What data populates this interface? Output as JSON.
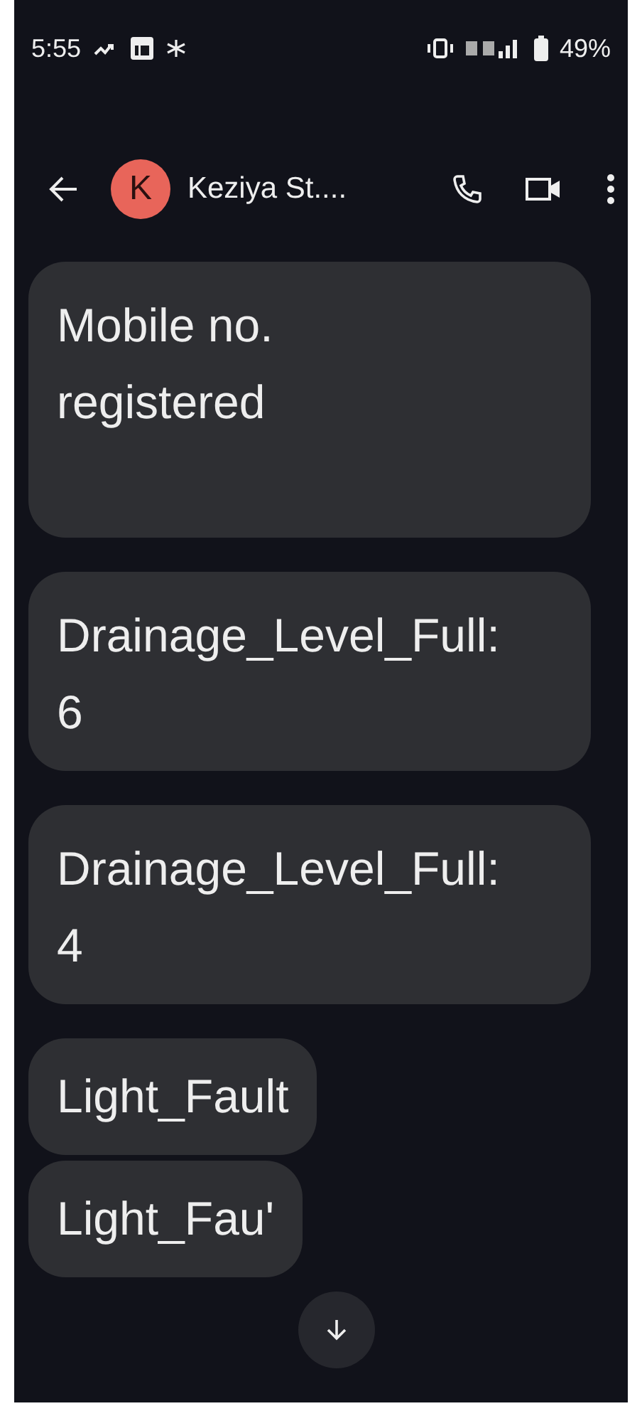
{
  "status_bar": {
    "time": "5:55",
    "battery": "49%"
  },
  "header": {
    "avatar_letter": "K",
    "contact_name": "Keziya St...."
  },
  "messages": [
    {
      "text": "Mobile no.\nregistered\n "
    },
    {
      "text": "Drainage_Level_Full:\n6"
    },
    {
      "text": "Drainage_Level_Full:\n4"
    },
    {
      "text": "Light_Fault"
    },
    {
      "text": "Light_Fau'"
    }
  ]
}
